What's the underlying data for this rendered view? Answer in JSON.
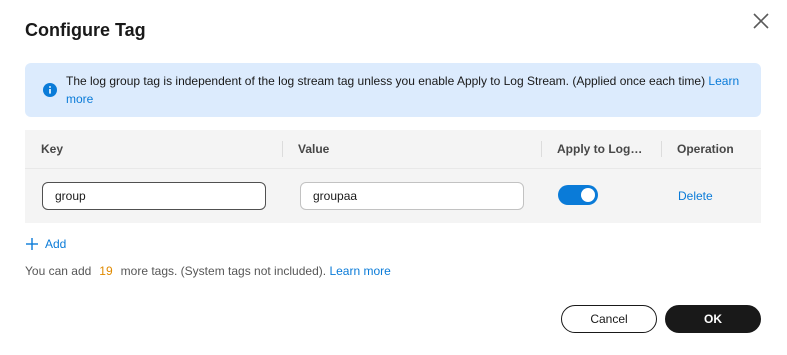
{
  "dialog": {
    "title": "Configure Tag",
    "close_icon": "close-icon"
  },
  "info": {
    "icon": "info-icon",
    "text": "The log group tag is independent of the log stream tag unless you enable Apply to Log Stream. (Applied once each time)",
    "link": "Learn more"
  },
  "table": {
    "headers": {
      "key": "Key",
      "value": "Value",
      "apply": "Apply to Log…",
      "operation": "Operation"
    },
    "rows": [
      {
        "key": "group",
        "value": "groupaa",
        "apply_to_log_stream": true,
        "operation": "Delete"
      }
    ]
  },
  "add": {
    "icon": "plus-icon",
    "label": "Add"
  },
  "note": {
    "prefix": "You can add",
    "count": "19",
    "suffix": "more tags. (System tags not included).",
    "link": "Learn more"
  },
  "footer": {
    "cancel": "Cancel",
    "ok": "OK"
  },
  "colors": {
    "accent": "#0a7bd8",
    "info_bg": "#dcebfd",
    "count": "#e08a00",
    "primary_btn": "#191919"
  }
}
